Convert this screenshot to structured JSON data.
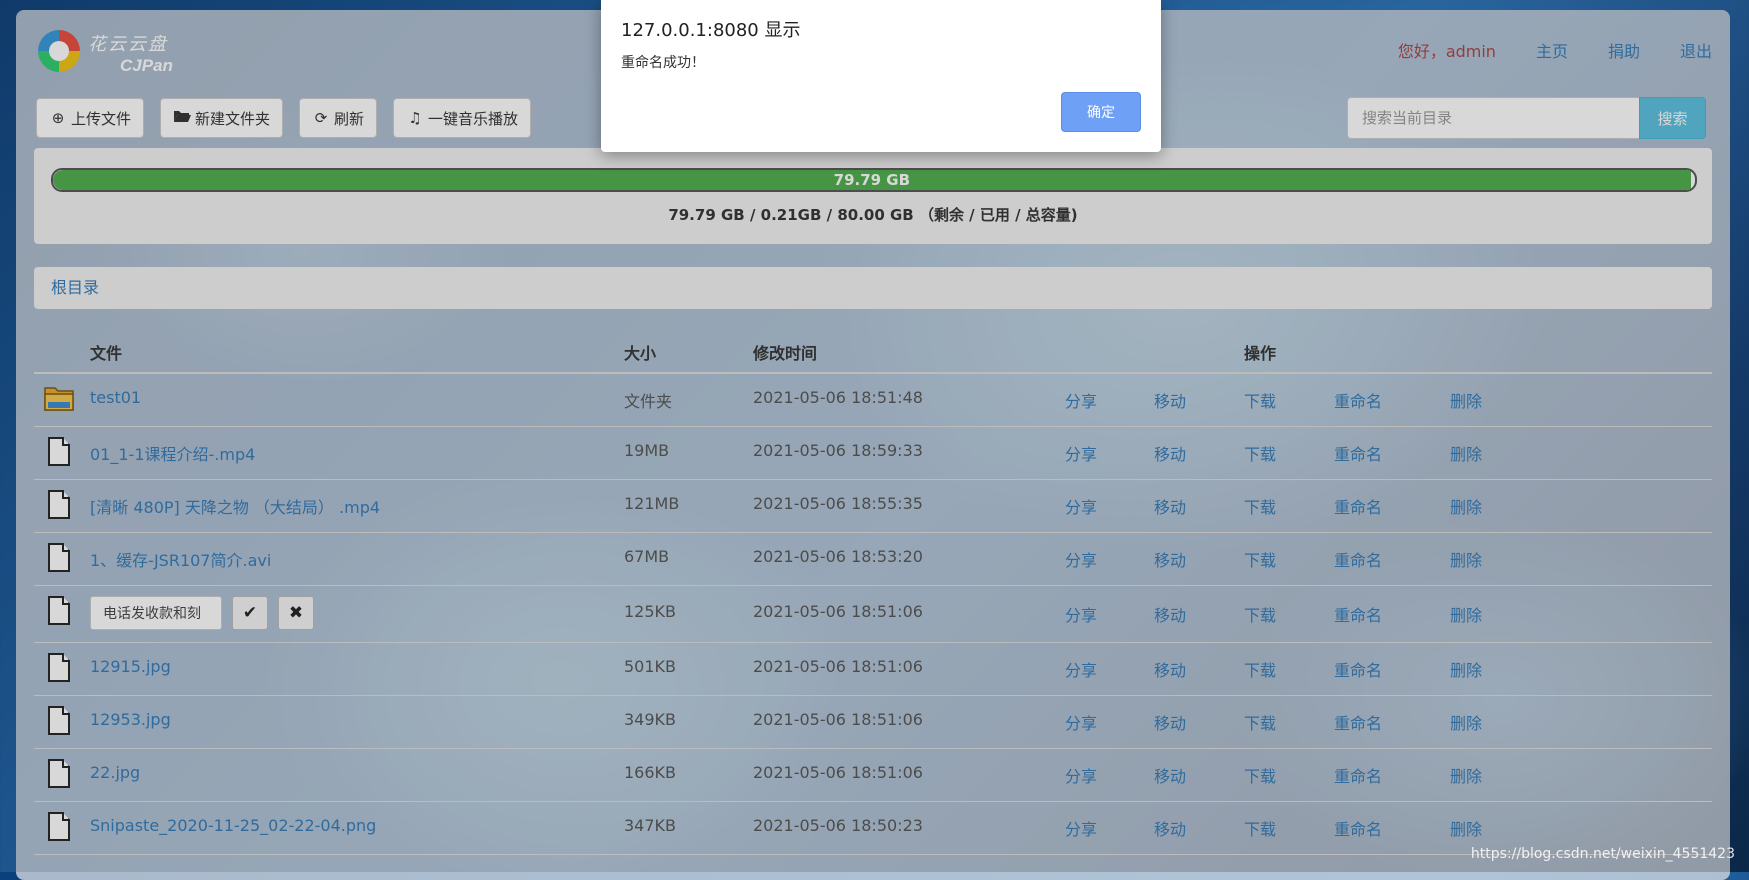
{
  "header": {
    "logo_cn": "花云云盘",
    "logo_en": "CJPan",
    "greeting": "您好，admin",
    "nav": [
      "主页",
      "捐助",
      "退出"
    ]
  },
  "toolbar": {
    "upload": "上传文件",
    "new_folder": "新建文件夹",
    "refresh": "刷新",
    "music": "一键音乐播放"
  },
  "search": {
    "placeholder": "搜索当前目录",
    "button": "搜索"
  },
  "storage": {
    "remaining_label": "79.79 GB",
    "used_fraction": 0.9974,
    "summary": "79.79 GB / 0.21GB / 80.00 GB （剩余 / 已用 / 总容量)"
  },
  "breadcrumb": {
    "root": "根目录"
  },
  "table": {
    "headers": {
      "file": "文件",
      "size": "大小",
      "time": "修改时间",
      "ops": "操作"
    },
    "actions": [
      "分享",
      "移动",
      "下载",
      "重命名",
      "删除"
    ],
    "rows": [
      {
        "type": "folder",
        "name": "test01",
        "size": "文件夹",
        "time": "2021-05-06 18:51:48"
      },
      {
        "type": "file",
        "name": "01_1-1课程介绍-.mp4",
        "size": "19MB",
        "time": "2021-05-06 18:59:33"
      },
      {
        "type": "file",
        "name": "[清晰 480P] 天降之物 （大结局） .mp4",
        "size": "121MB",
        "time": "2021-05-06 18:55:35"
      },
      {
        "type": "file",
        "name": "1、缓存-JSR107简介.avi",
        "size": "67MB",
        "time": "2021-05-06 18:53:20"
      },
      {
        "type": "editing",
        "name": "电话发收款和刻",
        "size": "125KB",
        "time": "2021-05-06 18:51:06"
      },
      {
        "type": "file",
        "name": "12915.jpg",
        "size": "501KB",
        "time": "2021-05-06 18:51:06"
      },
      {
        "type": "file",
        "name": "12953.jpg",
        "size": "349KB",
        "time": "2021-05-06 18:51:06"
      },
      {
        "type": "file",
        "name": "22.jpg",
        "size": "166KB",
        "time": "2021-05-06 18:51:06"
      },
      {
        "type": "file",
        "name": "Snipaste_2020-11-25_02-22-04.png",
        "size": "347KB",
        "time": "2021-05-06 18:50:23"
      }
    ],
    "confirm_icon": "check-icon",
    "cancel_icon": "close-icon"
  },
  "dialog": {
    "title": "127.0.0.1:8080 显示",
    "message": "重命名成功！",
    "ok": "确定"
  },
  "watermark": "https://blog.csdn.net/weixin_4551423",
  "colors": {
    "link": "#337ab7",
    "progress": "#4cae4c",
    "search_button": "#5bc0de",
    "dialog_button": "#6ea0f5",
    "greeting": "#a94442"
  }
}
